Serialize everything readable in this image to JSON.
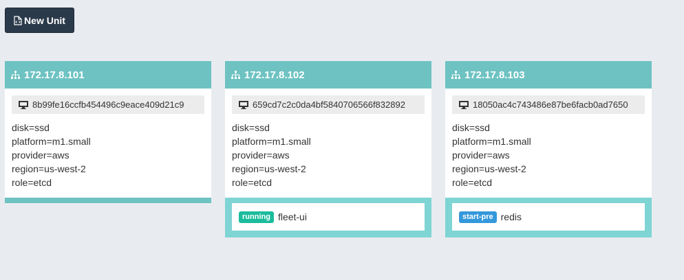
{
  "toolbar": {
    "new_unit_label": "New Unit"
  },
  "icons": {
    "new_unit": "file-code-icon",
    "machine": "sitemap-icon",
    "machine_id": "desktop-icon"
  },
  "colors": {
    "header": "#6ec2c2",
    "units_panel": "#7fd4d4",
    "running": "#1abc9c",
    "start_pre": "#3498db",
    "button": "#2b3a4a"
  },
  "machines": [
    {
      "ip": "172.17.8.101",
      "id": "8b99fe16ccfb454496c9eace409d21c9",
      "metadata": [
        "disk=ssd",
        "platform=m1.small",
        "provider=aws",
        "region=us-west-2",
        "role=etcd"
      ],
      "units": []
    },
    {
      "ip": "172.17.8.102",
      "id": "659cd7c2c0da4bf5840706566f832892",
      "metadata": [
        "disk=ssd",
        "platform=m1.small",
        "provider=aws",
        "region=us-west-2",
        "role=etcd"
      ],
      "units": [
        {
          "state": "running",
          "name": "fleet-ui"
        }
      ]
    },
    {
      "ip": "172.17.8.103",
      "id": "18050ac4c743486e87be6facb0ad7650",
      "metadata": [
        "disk=ssd",
        "platform=m1.small",
        "provider=aws",
        "region=us-west-2",
        "role=etcd"
      ],
      "units": [
        {
          "state": "start-pre",
          "name": "redis"
        }
      ]
    }
  ]
}
